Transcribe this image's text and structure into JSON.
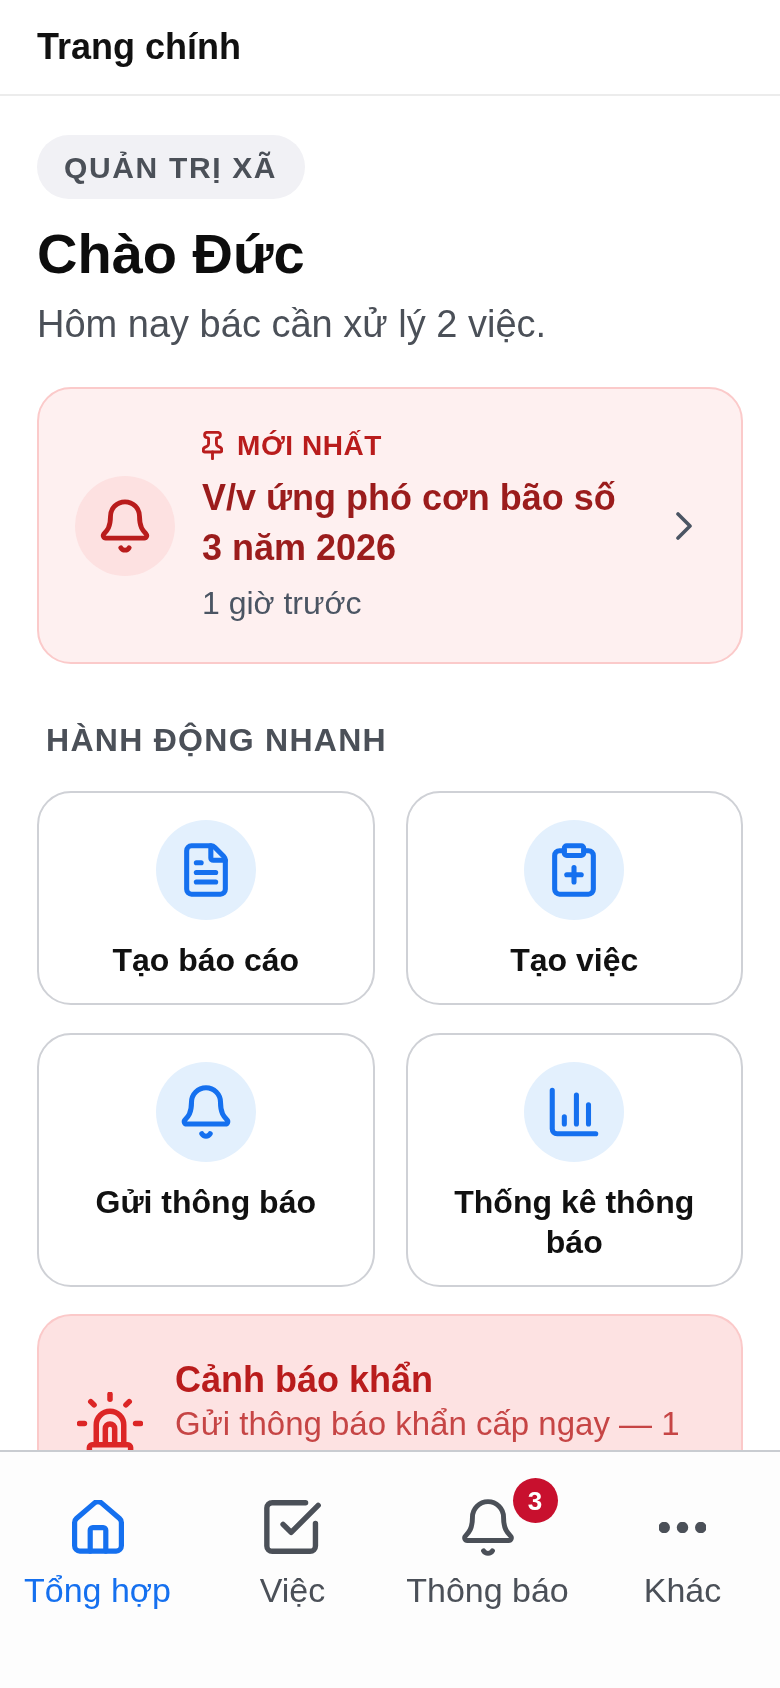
{
  "header": {
    "title": "Trang chính"
  },
  "role_badge": "QUẢN TRỊ XÃ",
  "greeting": "Chào Đức",
  "summary": "Hôm nay bác cần xử lý 2 việc.",
  "latest_notice": {
    "label": "MỚI NHẤT",
    "title": "V/v ứng phó cơn bão số 3 năm 2026",
    "time": "1 giờ trước"
  },
  "quick_actions": {
    "heading": "HÀNH ĐỘNG NHANH",
    "items": [
      {
        "label": "Tạo báo cáo"
      },
      {
        "label": "Tạo việc"
      },
      {
        "label": "Gửi thông báo"
      },
      {
        "label": "Thống kê thông báo"
      }
    ]
  },
  "emergency": {
    "title": "Cảnh báo khẩn",
    "subtitle": "Gửi thông báo khẩn cấp ngay — 1"
  },
  "tabs": [
    {
      "label": "Tổng hợp",
      "selected": true
    },
    {
      "label": "Việc",
      "selected": false
    },
    {
      "label": "Thông báo",
      "selected": false,
      "badge": "3"
    },
    {
      "label": "Khác",
      "selected": false
    }
  ]
}
